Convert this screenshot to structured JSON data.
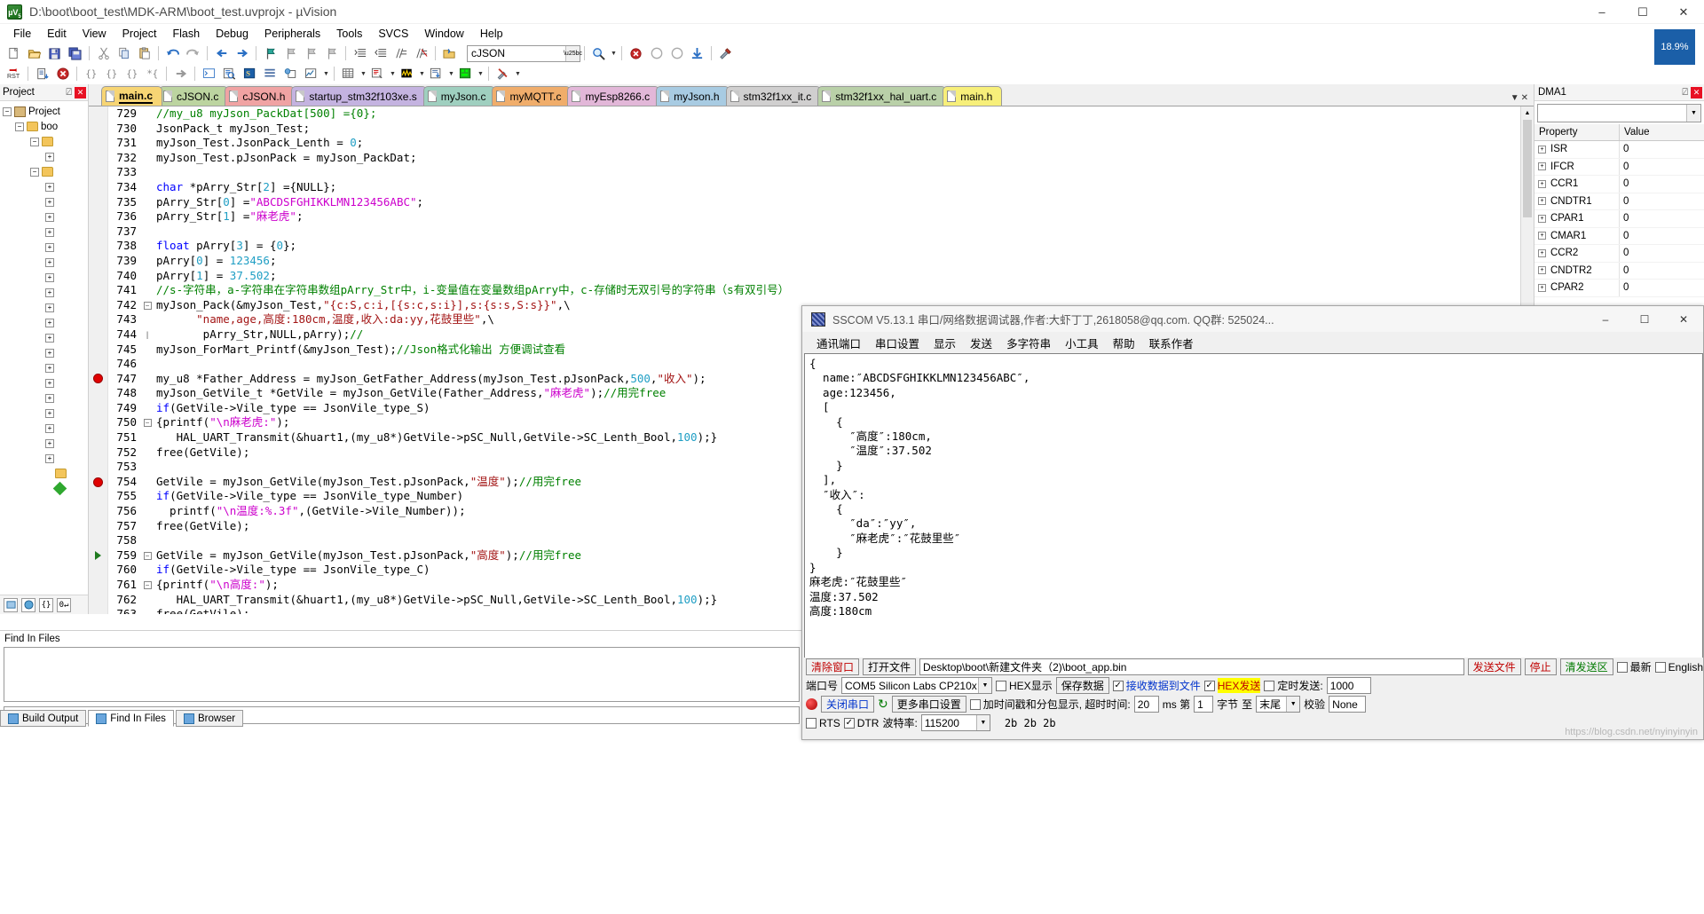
{
  "window": {
    "title": "D:\\boot\\boot_test\\MDK-ARM\\boot_test.uvprojx - µVision",
    "app_icon": "uvision-icon",
    "minimize": "–",
    "maximize": "☐",
    "close": "✕",
    "zoom_badge": "18.9%"
  },
  "menubar": [
    "File",
    "Edit",
    "View",
    "Project",
    "Flash",
    "Debug",
    "Peripherals",
    "Tools",
    "SVCS",
    "Window",
    "Help"
  ],
  "toolbar1": {
    "target_combo": "cJSON",
    "icons": [
      "new-file-icon",
      "open-file-icon",
      "save-icon",
      "save-all-icon",
      "cut-icon",
      "copy-icon",
      "paste-icon",
      "undo-icon",
      "redo-icon",
      "back-icon",
      "forward-icon",
      "bookmark-toggle-icon",
      "bookmark-prev-icon",
      "bookmark-next-icon",
      "bookmark-clear-icon",
      "indent-icon",
      "outdent-icon",
      "comment-icon",
      "uncomment-icon",
      "target-options-icon"
    ],
    "right_icons": [
      "find-in-files-icon",
      "build-icon",
      "rebuild-icon",
      "batch-build-icon",
      "download-icon",
      "manage-target-icon"
    ]
  },
  "toolbar2": {
    "icons": [
      "reset-icon",
      "load-icon",
      "stop-debug-icon",
      "step-into-icon",
      "step-over-icon",
      "step-out-icon",
      "run-to-cursor-icon",
      "show-next-statement-icon",
      "command-window-icon",
      "disassembly-icon",
      "symbols-icon",
      "registers-icon",
      "call-stack-icon",
      "watch-window-icon",
      "memory-window-icon",
      "serial-window-icon",
      "analysis-window-icon",
      "trace-icon",
      "system-viewer-icon",
      "toolbox-icon"
    ]
  },
  "project_panel": {
    "title": "Project",
    "pin": "⍁",
    "close": "✕",
    "root": "Project",
    "node": "boo",
    "footer_buttons": [
      "project-tab-icon",
      "books-tab-icon",
      "functions-tab-icon",
      "templates-tab-icon"
    ]
  },
  "editor": {
    "tabs": [
      {
        "label": "main.c",
        "color": "#f7d574",
        "active": true
      },
      {
        "label": "cJSON.c",
        "color": "#bcd4a0",
        "active": false
      },
      {
        "label": "cJSON.h",
        "color": "#f0a3a3",
        "active": false
      },
      {
        "label": "startup_stm32f103xe.s",
        "color": "#c4b3e0",
        "active": false
      },
      {
        "label": "myJson.c",
        "color": "#9fcfbf",
        "active": false
      },
      {
        "label": "myMQTT.c",
        "color": "#f0ad6b",
        "active": false
      },
      {
        "label": "myEsp8266.c",
        "color": "#e2b7d8",
        "active": false
      },
      {
        "label": "myJson.h",
        "color": "#a8cbe2",
        "active": false
      },
      {
        "label": "stm32f1xx_it.c",
        "color": "#d0cfcf",
        "active": false
      },
      {
        "label": "stm32f1xx_hal_uart.c",
        "color": "#b9d0a8",
        "active": false
      },
      {
        "label": "main.h",
        "color": "#f7ef7a",
        "active": false
      }
    ],
    "tab_nav": {
      "dropdown": "▼",
      "close": "✕"
    },
    "first_line": 729,
    "lines": [
      {
        "n": 729,
        "bp": "",
        "fold": "",
        "tokens": [
          {
            "t": "//my_u8 myJson_PackDat[500] ={0};",
            "c": "cm"
          }
        ]
      },
      {
        "n": 730,
        "bp": "",
        "fold": "",
        "tokens": [
          {
            "t": "JsonPack_t myJson_Test;",
            "c": ""
          }
        ]
      },
      {
        "n": 731,
        "bp": "",
        "fold": "",
        "tokens": [
          {
            "t": "myJson_Test.JsonPack_Lenth = ",
            "c": ""
          },
          {
            "t": "0",
            "c": "num"
          },
          {
            "t": ";",
            "c": ""
          }
        ]
      },
      {
        "n": 732,
        "bp": "",
        "fold": "",
        "tokens": [
          {
            "t": "myJson_Test.pJsonPack = myJson_PackDat;",
            "c": ""
          }
        ]
      },
      {
        "n": 733,
        "bp": "",
        "fold": "",
        "tokens": [
          {
            "t": "",
            "c": ""
          }
        ]
      },
      {
        "n": 734,
        "bp": "",
        "fold": "",
        "tokens": [
          {
            "t": "char",
            "c": "kw"
          },
          {
            "t": " *pArry_Str[",
            "c": ""
          },
          {
            "t": "2",
            "c": "num"
          },
          {
            "t": "] ={NULL};",
            "c": ""
          }
        ]
      },
      {
        "n": 735,
        "bp": "",
        "fold": "",
        "tokens": [
          {
            "t": "pArry_Str[",
            "c": ""
          },
          {
            "t": "0",
            "c": "num"
          },
          {
            "t": "] =",
            "c": ""
          },
          {
            "t": "\"ABCDSFGHIKKLMN123456ABC\"",
            "c": "st2"
          },
          {
            "t": ";",
            "c": ""
          }
        ]
      },
      {
        "n": 736,
        "bp": "",
        "fold": "",
        "tokens": [
          {
            "t": "pArry_Str[",
            "c": ""
          },
          {
            "t": "1",
            "c": "num"
          },
          {
            "t": "] =",
            "c": ""
          },
          {
            "t": "\"麻老虎\"",
            "c": "st2"
          },
          {
            "t": ";",
            "c": ""
          }
        ]
      },
      {
        "n": 737,
        "bp": "",
        "fold": "",
        "tokens": [
          {
            "t": "",
            "c": ""
          }
        ]
      },
      {
        "n": 738,
        "bp": "",
        "fold": "",
        "tokens": [
          {
            "t": "float",
            "c": "kw"
          },
          {
            "t": " pArry[",
            "c": ""
          },
          {
            "t": "3",
            "c": "num"
          },
          {
            "t": "] = {",
            "c": ""
          },
          {
            "t": "0",
            "c": "num"
          },
          {
            "t": "};",
            "c": ""
          }
        ]
      },
      {
        "n": 739,
        "bp": "",
        "fold": "",
        "tokens": [
          {
            "t": "pArry[",
            "c": ""
          },
          {
            "t": "0",
            "c": "num"
          },
          {
            "t": "] = ",
            "c": ""
          },
          {
            "t": "123456",
            "c": "num"
          },
          {
            "t": ";",
            "c": ""
          }
        ]
      },
      {
        "n": 740,
        "bp": "",
        "fold": "",
        "tokens": [
          {
            "t": "pArry[",
            "c": ""
          },
          {
            "t": "1",
            "c": "num"
          },
          {
            "t": "] = ",
            "c": ""
          },
          {
            "t": "37.502",
            "c": "num"
          },
          {
            "t": ";",
            "c": ""
          }
        ]
      },
      {
        "n": 741,
        "bp": "",
        "fold": "",
        "tokens": [
          {
            "t": "//s-字符串，a-字符串在字符串数组pArry_Str中，i-变量值在变量数组pArry中，c-存储时无双引号的字符串（s有双引号）",
            "c": "cm"
          }
        ]
      },
      {
        "n": 742,
        "bp": "",
        "fold": "−",
        "tokens": [
          {
            "t": "myJson_Pack(&myJson_Test,",
            "c": ""
          },
          {
            "t": "\"{c:S,c:i,[{s:c,s:i}],s:{s:s,S:s}}\"",
            "c": "st"
          },
          {
            "t": ",\\",
            "c": ""
          }
        ]
      },
      {
        "n": 743,
        "bp": "",
        "fold": "",
        "tokens": [
          {
            "t": "      ",
            "c": ""
          },
          {
            "t": "\"name,age,高度:180cm,温度,收入:da:yy,花鼓里些\"",
            "c": "st"
          },
          {
            "t": ",\\",
            "c": ""
          }
        ]
      },
      {
        "n": 744,
        "bp": "",
        "fold": "|",
        "tokens": [
          {
            "t": "       pArry_Str,NULL,pArry);",
            "c": ""
          },
          {
            "t": "//",
            "c": "cm"
          }
        ]
      },
      {
        "n": 745,
        "bp": "",
        "fold": "",
        "tokens": [
          {
            "t": "myJson_ForMart_Printf(&myJson_Test);",
            "c": ""
          },
          {
            "t": "//Json格式化输出 方便调试查看",
            "c": "cm"
          }
        ]
      },
      {
        "n": 746,
        "bp": "",
        "fold": "",
        "tokens": [
          {
            "t": "",
            "c": ""
          }
        ]
      },
      {
        "n": 747,
        "bp": "dot",
        "fold": "",
        "tokens": [
          {
            "t": "my_u8 *Father_Address = myJson_GetFather_Address(myJson_Test.pJsonPack,",
            "c": ""
          },
          {
            "t": "500",
            "c": "num"
          },
          {
            "t": ",",
            "c": ""
          },
          {
            "t": "\"收入\"",
            "c": "st"
          },
          {
            "t": ");",
            "c": ""
          }
        ]
      },
      {
        "n": 748,
        "bp": "",
        "fold": "",
        "tokens": [
          {
            "t": "myJson_GetVile_t *GetVile = myJson_GetVile(Father_Address,",
            "c": ""
          },
          {
            "t": "\"麻老虎\"",
            "c": "st2"
          },
          {
            "t": ");",
            "c": ""
          },
          {
            "t": "//用完free",
            "c": "cm"
          }
        ]
      },
      {
        "n": 749,
        "bp": "",
        "fold": "",
        "tokens": [
          {
            "t": "if",
            "c": "kw"
          },
          {
            "t": "(GetVile->Vile_type == JsonVile_type_S)",
            "c": ""
          }
        ]
      },
      {
        "n": 750,
        "bp": "",
        "fold": "−",
        "tokens": [
          {
            "t": "{printf(",
            "c": ""
          },
          {
            "t": "\"\\n麻老虎:\"",
            "c": "st2"
          },
          {
            "t": ");",
            "c": ""
          }
        ]
      },
      {
        "n": 751,
        "bp": "",
        "fold": "",
        "tokens": [
          {
            "t": "   HAL_UART_Transmit(&huart1,(my_u8*)GetVile->pSC_Null,GetVile->SC_Lenth_Bool,",
            "c": ""
          },
          {
            "t": "100",
            "c": "num"
          },
          {
            "t": ");}",
            "c": ""
          }
        ]
      },
      {
        "n": 752,
        "bp": "",
        "fold": "",
        "tokens": [
          {
            "t": "free(GetVile);",
            "c": ""
          }
        ]
      },
      {
        "n": 753,
        "bp": "",
        "fold": "",
        "tokens": [
          {
            "t": "",
            "c": ""
          }
        ]
      },
      {
        "n": 754,
        "bp": "dot",
        "fold": "",
        "tokens": [
          {
            "t": "GetVile = myJson_GetVile(myJson_Test.pJsonPack,",
            "c": ""
          },
          {
            "t": "\"温度\"",
            "c": "st"
          },
          {
            "t": ");",
            "c": ""
          },
          {
            "t": "//用完free",
            "c": "cm"
          }
        ]
      },
      {
        "n": 755,
        "bp": "",
        "fold": "",
        "tokens": [
          {
            "t": "if",
            "c": "kw"
          },
          {
            "t": "(GetVile->Vile_type == JsonVile_type_Number)",
            "c": ""
          }
        ]
      },
      {
        "n": 756,
        "bp": "",
        "fold": "",
        "tokens": [
          {
            "t": "  printf(",
            "c": ""
          },
          {
            "t": "\"\\n温度:%.3f\"",
            "c": "st2"
          },
          {
            "t": ",(GetVile->Vile_Number));",
            "c": ""
          }
        ]
      },
      {
        "n": 757,
        "bp": "",
        "fold": "",
        "tokens": [
          {
            "t": "free(GetVile);",
            "c": ""
          }
        ]
      },
      {
        "n": 758,
        "bp": "",
        "fold": "",
        "tokens": [
          {
            "t": "",
            "c": ""
          }
        ]
      },
      {
        "n": 759,
        "bp": "arrow",
        "fold": "−",
        "tokens": [
          {
            "t": "GetVile = myJson_GetVile(myJson_Test.pJsonPack,",
            "c": ""
          },
          {
            "t": "\"高度\"",
            "c": "st"
          },
          {
            "t": ");",
            "c": ""
          },
          {
            "t": "//用完free",
            "c": "cm"
          }
        ]
      },
      {
        "n": 760,
        "bp": "",
        "fold": "",
        "tokens": [
          {
            "t": "if",
            "c": "kw"
          },
          {
            "t": "(GetVile->Vile_type == JsonVile_type_C)",
            "c": ""
          }
        ]
      },
      {
        "n": 761,
        "bp": "",
        "fold": "−",
        "tokens": [
          {
            "t": "{printf(",
            "c": ""
          },
          {
            "t": "\"\\n高度:\"",
            "c": "st2"
          },
          {
            "t": ");",
            "c": ""
          }
        ]
      },
      {
        "n": 762,
        "bp": "",
        "fold": "",
        "tokens": [
          {
            "t": "   HAL_UART_Transmit(&huart1,(my_u8*)GetVile->pSC_Null,GetVile->SC_Lenth_Bool,",
            "c": ""
          },
          {
            "t": "100",
            "c": "num"
          },
          {
            "t": ");}",
            "c": ""
          }
        ]
      },
      {
        "n": 763,
        "bp": "",
        "fold": "",
        "tokens": [
          {
            "t": "free(GetVile);",
            "c": ""
          }
        ]
      }
    ]
  },
  "dma_panel": {
    "title": "DMA1",
    "pin": "⍁",
    "close": "✕",
    "columns": [
      "Property",
      "Value"
    ],
    "rows": [
      {
        "property": "ISR",
        "value": "0"
      },
      {
        "property": "IFCR",
        "value": "0"
      },
      {
        "property": "CCR1",
        "value": "0"
      },
      {
        "property": "CNDTR1",
        "value": "0"
      },
      {
        "property": "CPAR1",
        "value": "0"
      },
      {
        "property": "CMAR1",
        "value": "0"
      },
      {
        "property": "CCR2",
        "value": "0"
      },
      {
        "property": "CNDTR2",
        "value": "0"
      },
      {
        "property": "CPAR2",
        "value": "0"
      }
    ]
  },
  "find_panel": {
    "title": "Find In Files",
    "input_value": "",
    "results": ""
  },
  "bottom_tabs": [
    {
      "label": "Build Output",
      "icon": "build-output-icon",
      "active": false
    },
    {
      "label": "Find In Files",
      "icon": "find-in-files-icon",
      "active": true
    },
    {
      "label": "Browser",
      "icon": "browser-icon",
      "active": false
    }
  ],
  "sscom": {
    "title": "SSCOM V5.13.1 串口/网络数据调试器,作者:大虾丁丁,2618058@qq.com. QQ群: 525024...",
    "icon": "sscom-icon",
    "minimize": "–",
    "maximize": "☐",
    "close": "✕",
    "menu": [
      "通讯端口",
      "串口设置",
      "显示",
      "发送",
      "多字符串",
      "小工具",
      "帮助",
      "联系作者"
    ],
    "received": "{\n  name:″ABCDSFGHIKKLMN123456ABC″,\n  age:123456,\n  [\n    {\n      ″高度″:180cm,\n      ″温度″:37.502\n    }\n  ],\n  ″收入″:\n    {\n      ″da″:″yy″,\n      ″麻老虎″:″花鼓里些″\n    }\n}\n麻老虎:″花鼓里些″\n温度:37.502\n高度:180cm",
    "controls": {
      "clear_window": "清除窗口",
      "open_file": "打开文件",
      "file_path": "Desktop\\boot\\新建文件夹（2)\\boot_app.bin",
      "send_file": "发送文件",
      "stop": "停止",
      "clear_send": "清发送区",
      "latest_label": "最新",
      "english_label": "English",
      "port_label": "端口号",
      "port_value": "COM5 Silicon Labs CP210x",
      "hex_display": "HEX显示",
      "save_data": "保存数据",
      "recv_to_file": "接收数据到文件",
      "hex_send": "HEX发送",
      "timed_send": "定时发送:",
      "timed_value": "1000",
      "close_port": "关闭串口",
      "refresh_icon": "refresh-icon",
      "more_settings": "更多串口设置",
      "timestamp": "加时间戳和分包显示, 超时时间:",
      "timeout_value": "20",
      "ms_label": "ms 第",
      "frame_value": "1",
      "byte_label": "字节",
      "to_label": "至",
      "end_label": "末尾",
      "checksum": "校验",
      "checksum_value": "None",
      "rts": "RTS",
      "dtr": "DTR",
      "baud_label": "波特率:",
      "baud_value": "115200",
      "send_area": "2b 2b 2b"
    },
    "watermark": "https://blog.csdn.net/nyinyinyin"
  }
}
